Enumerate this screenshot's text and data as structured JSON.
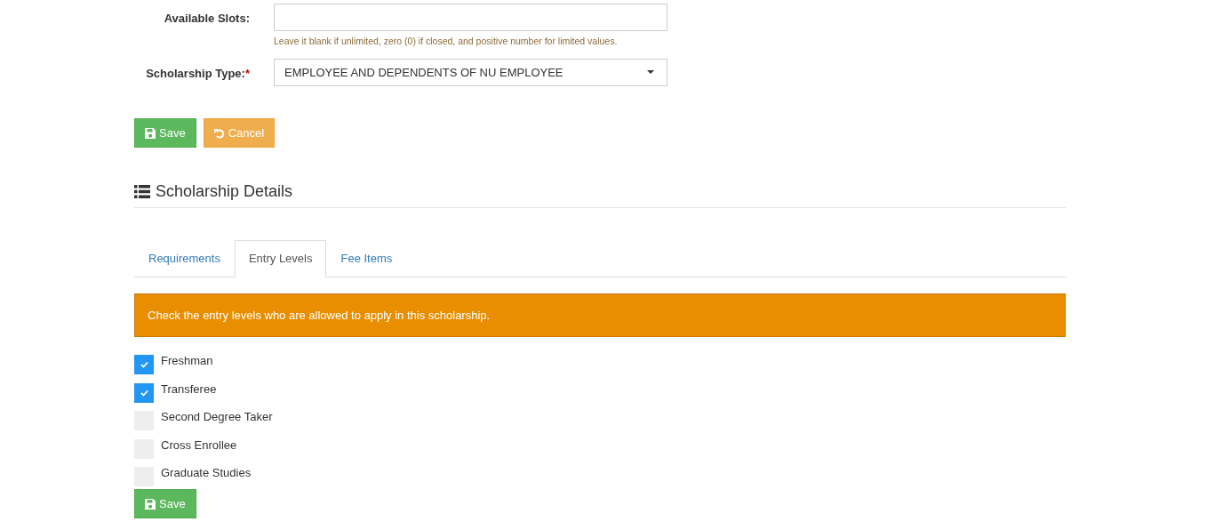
{
  "form": {
    "fields": [
      {
        "kind": "input",
        "label": "Available Slots:",
        "help": "Leave it blank if unlimited, zero (0) if closed, and positive number for limited values."
      },
      {
        "kind": "select",
        "label": "Scholarship Type:",
        "required_mark": "*",
        "value": "EMPLOYEE AND DEPENDENTS OF NU EMPLOYEE"
      }
    ],
    "buttons": [
      {
        "kind": "save",
        "label": "Save"
      },
      {
        "kind": "cancel",
        "label": "Cancel"
      }
    ]
  },
  "section": {
    "title": "Scholarship Details"
  },
  "tabs": [
    {
      "label": "Requirements",
      "selected": false
    },
    {
      "label": "Entry Levels",
      "selected": true
    },
    {
      "label": "Fee Items",
      "selected": false
    }
  ],
  "alert": "Check the entry levels who are allowed to apply in this scholarship.",
  "entry_levels": [
    {
      "label": "Freshman",
      "checked": true
    },
    {
      "label": "Transferee",
      "checked": true
    },
    {
      "label": "Second Degree Taker",
      "checked": false
    },
    {
      "label": "Cross Enrollee",
      "checked": false
    },
    {
      "label": "Graduate Studies",
      "checked": false
    }
  ],
  "save_button": "Save"
}
